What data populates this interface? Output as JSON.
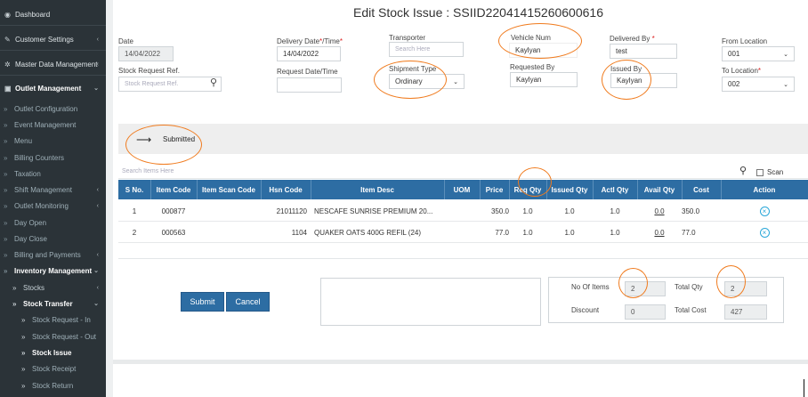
{
  "sidebar": {
    "items": [
      {
        "label": "Dashboard",
        "icon": "dashboard-icon",
        "glyph": "◉"
      },
      {
        "label": "Customer Settings",
        "icon": "wrench-icon",
        "glyph": "✎"
      },
      {
        "label": "Master Data Management",
        "icon": "gear-icon",
        "glyph": "✲"
      },
      {
        "label": "Outlet Management",
        "icon": "outlet-icon",
        "glyph": "▣"
      },
      {
        "label": "Outlet Configuration"
      },
      {
        "label": "Event Management"
      },
      {
        "label": "Menu"
      },
      {
        "label": "Billing Counters"
      },
      {
        "label": "Taxation"
      },
      {
        "label": "Shift Management"
      },
      {
        "label": "Outlet Monitoring"
      },
      {
        "label": "Day Open"
      },
      {
        "label": "Day Close"
      },
      {
        "label": "Billing and Payments"
      },
      {
        "label": "Inventory Management"
      },
      {
        "label": "Stocks"
      },
      {
        "label": "Stock Transfer"
      },
      {
        "label": "Stock Request - In"
      },
      {
        "label": "Stock Request - Out"
      },
      {
        "label": "Stock Issue"
      },
      {
        "label": "Stock Receipt"
      },
      {
        "label": "Stock Return"
      }
    ],
    "chevron_glyph": "‹",
    "chevron_open_glyph": "⌄",
    "sub_glyph": "»"
  },
  "page": {
    "title": "Edit Stock Issue : SSIID22041415260600616"
  },
  "form": {
    "date": {
      "label": "Date",
      "value": "14/04/2022"
    },
    "delivery_date": {
      "label": "Delivery Date",
      "required_mark": "*",
      "label_suffix": "/Time",
      "required_mark2": "*",
      "value": "14/04/2022"
    },
    "transporter": {
      "label": "Transporter",
      "placeholder": "Search Here"
    },
    "vehicle_num": {
      "label": "Vehicle Num",
      "value": "Kaylyan"
    },
    "delivered_by": {
      "label": "Delivered By",
      "required_mark": "*",
      "value": "test"
    },
    "from_location": {
      "label": "From Location",
      "value": "001"
    },
    "stock_request_ref": {
      "label": "Stock Request Ref.",
      "placeholder": "Stock Request Ref."
    },
    "request_date": {
      "label": "Request Date/Time",
      "value": ""
    },
    "shipment_type": {
      "label": "Shipment Type",
      "value": "Ordinary"
    },
    "requested_by": {
      "label": "Requested By",
      "value": "Kaylyan"
    },
    "issued_by": {
      "label": "Issued By",
      "value": "Kaylyan"
    },
    "to_location": {
      "label": "To Location",
      "required_mark": "*",
      "value": "002"
    }
  },
  "status": {
    "arrow": "⟶",
    "text": "Submitted"
  },
  "search": {
    "placeholder": "Search Items Here",
    "scan_label": "Scan"
  },
  "table": {
    "headers": [
      "S No.",
      "Item Code",
      "Item Scan Code",
      "Hsn Code",
      "Item Desc",
      "UOM",
      "Price",
      "Req Qty",
      "Issued Qty",
      "Actl Qty",
      "Avail Qty",
      "Cost",
      "Action"
    ],
    "rows": [
      {
        "sno": "1",
        "item_code": "000877",
        "scan_code": "",
        "hsn": "21011120",
        "desc": "NESCAFE SUNRISE PREMIUM 20...",
        "uom": "",
        "price": "350.0",
        "req": "1.0",
        "issued": "1.0",
        "actl": "1.0",
        "avail": "0.0",
        "cost": "350.0",
        "action_glyph": "×"
      },
      {
        "sno": "2",
        "item_code": "000563",
        "scan_code": "",
        "hsn": "1104",
        "desc": "QUAKER OATS 400G REFIL (24)",
        "uom": "",
        "price": "77.0",
        "req": "1.0",
        "issued": "1.0",
        "actl": "1.0",
        "avail": "0.0",
        "cost": "77.0",
        "action_glyph": "×"
      }
    ]
  },
  "buttons": {
    "submit": "Submit",
    "cancel": "Cancel"
  },
  "totals": {
    "no_of_items": {
      "label": "No Of Items",
      "value": "2"
    },
    "total_qty": {
      "label": "Total Qty",
      "value": "2"
    },
    "discount": {
      "label": "Discount",
      "value": "0"
    },
    "total_cost": {
      "label": "Total Cost",
      "value": "427"
    }
  },
  "colors": {
    "accent": "#2d6da3",
    "sidebar": "#2b3338",
    "annotation": "#f07b1e"
  }
}
